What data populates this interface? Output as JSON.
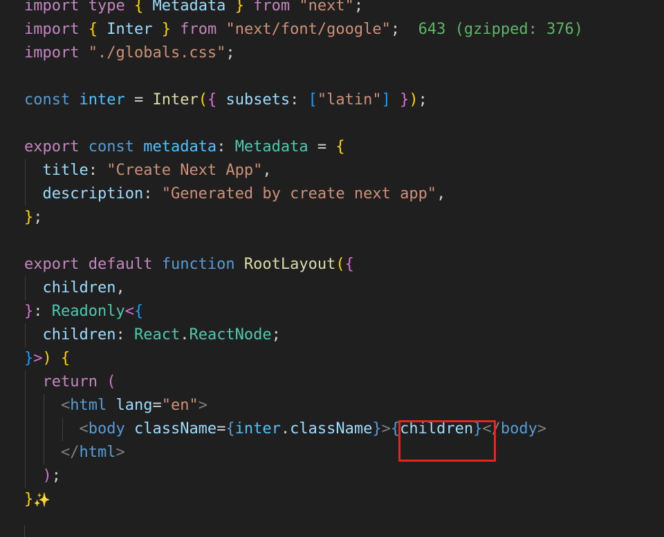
{
  "editor": {
    "language": "typescript",
    "theme": {
      "background": "#1f1f1f",
      "highlight_border": "#e8251b"
    },
    "lines": [
      [
        {
          "t": "import",
          "c": "kw"
        },
        {
          "t": " "
        },
        {
          "t": "type",
          "c": "kw"
        },
        {
          "t": " "
        },
        {
          "t": "{",
          "c": "b1"
        },
        {
          "t": " "
        },
        {
          "t": "Metadata",
          "c": "var"
        },
        {
          "t": " "
        },
        {
          "t": "}",
          "c": "b1"
        },
        {
          "t": " "
        },
        {
          "t": "from",
          "c": "kw"
        },
        {
          "t": " "
        },
        {
          "t": "\"next\"",
          "c": "str"
        },
        {
          "t": ";",
          "c": "punc"
        }
      ],
      [
        {
          "t": "import",
          "c": "kw"
        },
        {
          "t": " "
        },
        {
          "t": "{",
          "c": "b1"
        },
        {
          "t": " "
        },
        {
          "t": "Inter",
          "c": "var"
        },
        {
          "t": " "
        },
        {
          "t": "}",
          "c": "b1"
        },
        {
          "t": " "
        },
        {
          "t": "from",
          "c": "kw"
        },
        {
          "t": " "
        },
        {
          "t": "\"next/font/google\"",
          "c": "str"
        },
        {
          "t": ";",
          "c": "punc"
        },
        {
          "t": "  "
        },
        {
          "t": "643 (gzipped: 376)",
          "c": "hint"
        }
      ],
      [
        {
          "t": "import",
          "c": "kw"
        },
        {
          "t": " "
        },
        {
          "t": "\"./globals.css\"",
          "c": "str"
        },
        {
          "t": ";",
          "c": "punc"
        }
      ],
      [],
      [
        {
          "t": "const",
          "c": "bkw"
        },
        {
          "t": " "
        },
        {
          "t": "inter",
          "c": "cvar"
        },
        {
          "t": " = ",
          "c": "punc"
        },
        {
          "t": "Inter",
          "c": "fn"
        },
        {
          "t": "(",
          "c": "b1"
        },
        {
          "t": "{",
          "c": "b2"
        },
        {
          "t": " "
        },
        {
          "t": "subsets",
          "c": "var"
        },
        {
          "t": ": ",
          "c": "punc"
        },
        {
          "t": "[",
          "c": "b3"
        },
        {
          "t": "\"latin\"",
          "c": "str"
        },
        {
          "t": "]",
          "c": "b3"
        },
        {
          "t": " "
        },
        {
          "t": "}",
          "c": "b2"
        },
        {
          "t": ")",
          "c": "b1"
        },
        {
          "t": ";",
          "c": "punc"
        }
      ],
      [],
      [
        {
          "t": "export",
          "c": "kw"
        },
        {
          "t": " "
        },
        {
          "t": "const",
          "c": "bkw"
        },
        {
          "t": " "
        },
        {
          "t": "metadata",
          "c": "cvar"
        },
        {
          "t": ": ",
          "c": "punc"
        },
        {
          "t": "Metadata",
          "c": "type"
        },
        {
          "t": " = ",
          "c": "punc"
        },
        {
          "t": "{",
          "c": "b1"
        }
      ],
      [
        {
          "t": "  "
        },
        {
          "t": "title",
          "c": "var"
        },
        {
          "t": ": ",
          "c": "punc"
        },
        {
          "t": "\"Create Next App\"",
          "c": "str"
        },
        {
          "t": ",",
          "c": "punc"
        }
      ],
      [
        {
          "t": "  "
        },
        {
          "t": "description",
          "c": "var"
        },
        {
          "t": ": ",
          "c": "punc"
        },
        {
          "t": "\"Generated by create next app\"",
          "c": "str"
        },
        {
          "t": ",",
          "c": "punc"
        }
      ],
      [
        {
          "t": "}",
          "c": "b1"
        },
        {
          "t": ";",
          "c": "punc"
        }
      ],
      [],
      [
        {
          "t": "export",
          "c": "kw"
        },
        {
          "t": " "
        },
        {
          "t": "default",
          "c": "kw"
        },
        {
          "t": " "
        },
        {
          "t": "function",
          "c": "bkw"
        },
        {
          "t": " "
        },
        {
          "t": "RootLayout",
          "c": "fn"
        },
        {
          "t": "(",
          "c": "b1"
        },
        {
          "t": "{",
          "c": "b2"
        }
      ],
      [
        {
          "t": "  "
        },
        {
          "t": "children",
          "c": "var"
        },
        {
          "t": ",",
          "c": "punc"
        }
      ],
      [
        {
          "t": "}",
          "c": "b2"
        },
        {
          "t": ": ",
          "c": "punc"
        },
        {
          "t": "Readonly",
          "c": "type"
        },
        {
          "t": "<",
          "c": "b2"
        },
        {
          "t": "{",
          "c": "b3"
        }
      ],
      [
        {
          "t": "  "
        },
        {
          "t": "children",
          "c": "var"
        },
        {
          "t": ": ",
          "c": "punc"
        },
        {
          "t": "React",
          "c": "type"
        },
        {
          "t": ".",
          "c": "punc"
        },
        {
          "t": "ReactNode",
          "c": "type"
        },
        {
          "t": ";",
          "c": "punc"
        }
      ],
      [
        {
          "t": "}",
          "c": "b3"
        },
        {
          "t": ">",
          "c": "b2"
        },
        {
          "t": ")",
          "c": "b1"
        },
        {
          "t": " "
        },
        {
          "t": "{",
          "c": "b1"
        }
      ],
      [
        {
          "t": "  "
        },
        {
          "t": "return",
          "c": "kw"
        },
        {
          "t": " "
        },
        {
          "t": "(",
          "c": "b2"
        }
      ],
      [
        {
          "t": "    "
        },
        {
          "t": "<",
          "c": "tagp"
        },
        {
          "t": "html",
          "c": "tag"
        },
        {
          "t": " "
        },
        {
          "t": "lang",
          "c": "attr"
        },
        {
          "t": "=",
          "c": "punc"
        },
        {
          "t": "\"en\"",
          "c": "str"
        },
        {
          "t": ">",
          "c": "tagp"
        }
      ],
      [
        {
          "t": "      "
        },
        {
          "t": "<",
          "c": "tagp"
        },
        {
          "t": "body",
          "c": "tag"
        },
        {
          "t": " "
        },
        {
          "t": "className",
          "c": "attr"
        },
        {
          "t": "=",
          "c": "punc"
        },
        {
          "t": "{",
          "c": "bkw"
        },
        {
          "t": "inter",
          "c": "cvar"
        },
        {
          "t": ".",
          "c": "punc"
        },
        {
          "t": "className",
          "c": "var"
        },
        {
          "t": "}",
          "c": "bkw"
        },
        {
          "t": ">",
          "c": "tagp"
        },
        {
          "t": "{",
          "c": "bkw"
        },
        {
          "t": "children",
          "c": "var"
        },
        {
          "t": "}",
          "c": "bkw"
        },
        {
          "t": "</",
          "c": "tagp"
        },
        {
          "t": "body",
          "c": "tag"
        },
        {
          "t": ">",
          "c": "tagp"
        }
      ],
      [
        {
          "t": "    "
        },
        {
          "t": "</",
          "c": "tagp"
        },
        {
          "t": "html",
          "c": "tag"
        },
        {
          "t": ">",
          "c": "tagp"
        }
      ],
      [
        {
          "t": "  "
        },
        {
          "t": ")",
          "c": "b2"
        },
        {
          "t": ";",
          "c": "punc"
        }
      ],
      [
        {
          "t": "}",
          "c": "b1"
        },
        {
          "t": "",
          "sparkle": true
        }
      ]
    ],
    "guides": [
      [],
      [],
      [],
      [],
      [],
      [],
      [],
      [
        1
      ],
      [
        1
      ],
      [],
      [],
      [],
      [
        1
      ],
      [],
      [
        1
      ],
      [],
      [
        1
      ],
      [
        1,
        2
      ],
      [
        1,
        2,
        3
      ],
      [
        1,
        2
      ],
      [
        1
      ],
      []
    ],
    "sparkle_icon": "sparkle-icon"
  }
}
